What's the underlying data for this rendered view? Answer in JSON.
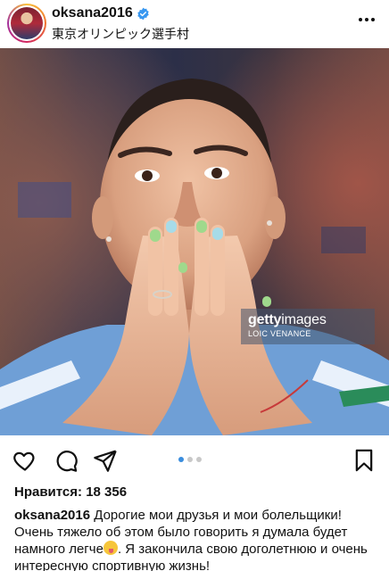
{
  "post": {
    "username": "oksana2016",
    "location": "東京オリンピック選手村",
    "verified": true,
    "verified_color": "#3897f0",
    "more_icon": "more-horizontal-icon"
  },
  "photo": {
    "description_icon": "photo",
    "watermark_brand_bold": "getty",
    "watermark_brand_rest": "images",
    "watermark_credit": "LOIC VENANCE"
  },
  "actions": {
    "like_icon": "heart-icon",
    "comment_icon": "comment-icon",
    "share_icon": "send-icon",
    "save_icon": "bookmark-icon",
    "carousel_total": 3,
    "carousel_active": 1,
    "active_dot_color": "#3a8dde"
  },
  "likes": {
    "label": "Нравится:",
    "count": "18 356"
  },
  "caption": {
    "username": "oksana2016",
    "text_part1": "Дорогие мои друзья и мои болельщики! Очень тяжело об этом было говорить я думала будет намного легче",
    "text_part2": ". Я закончила свою доголетнюю и очень интересную спортивную жизнь!"
  }
}
